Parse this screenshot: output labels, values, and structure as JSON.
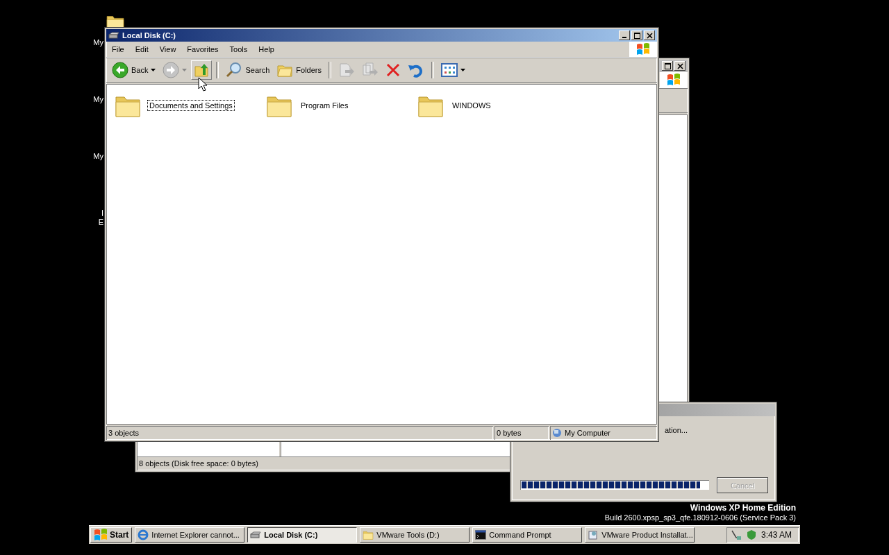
{
  "desktop_icons": [
    {
      "label": "My",
      "has_image": true
    },
    {
      "label": "My",
      "has_image": false
    },
    {
      "label": "My",
      "has_image": false
    },
    {
      "label": "I",
      "has_image": false
    },
    {
      "label": "E",
      "has_image": false
    }
  ],
  "background_window": {
    "status_text": "8 objects (Disk free space: 0 bytes)"
  },
  "progress_dialog": {
    "message": "ation...",
    "level": 0.96,
    "cancel_button": {
      "label": "Cancel",
      "disabled": true
    }
  },
  "explorer": {
    "title": "Local Disk (C:)",
    "menu": [
      "File",
      "Edit",
      "View",
      "Favorites",
      "Tools",
      "Help"
    ],
    "toolbar": [
      {
        "kind": "back",
        "label": "Back",
        "disabled": false
      },
      {
        "kind": "forward",
        "disabled": true
      },
      {
        "kind": "up",
        "disabled": false
      },
      {
        "kind": "search",
        "label": "Search",
        "disabled": false
      },
      {
        "kind": "folders",
        "label": "Folders",
        "disabled": false
      },
      {
        "kind": "move",
        "disabled": true
      },
      {
        "kind": "copy",
        "disabled": true
      },
      {
        "kind": "delete",
        "disabled": false
      },
      {
        "kind": "undo",
        "disabled": false
      },
      {
        "kind": "views",
        "disabled": false
      }
    ],
    "items": [
      {
        "name": "Documents and Settings",
        "focused": true
      },
      {
        "name": "Program Files",
        "focused": false
      },
      {
        "name": "WINDOWS",
        "focused": false
      }
    ],
    "status": {
      "count": "3 objects",
      "size": "0 bytes",
      "zone": "My Computer"
    }
  },
  "os_info": {
    "edition": "Windows XP Home Edition",
    "build": "Build 2600.xpsp_sp3_qfe.180912-0606 (Service Pack 3)"
  },
  "taskbar": {
    "start": "Start",
    "tasks": [
      {
        "kind": "ie",
        "label": "Internet Explorer cannot...",
        "selected": false
      },
      {
        "kind": "drive",
        "label": "Local Disk (C:)",
        "selected": true
      },
      {
        "kind": "folder",
        "label": "VMware Tools (D:)",
        "selected": false
      },
      {
        "kind": "console",
        "label": "Command Prompt",
        "selected": false
      },
      {
        "kind": "installer",
        "label": "VMware Product Installat...",
        "selected": false
      }
    ],
    "clock": "3:43 AM"
  }
}
